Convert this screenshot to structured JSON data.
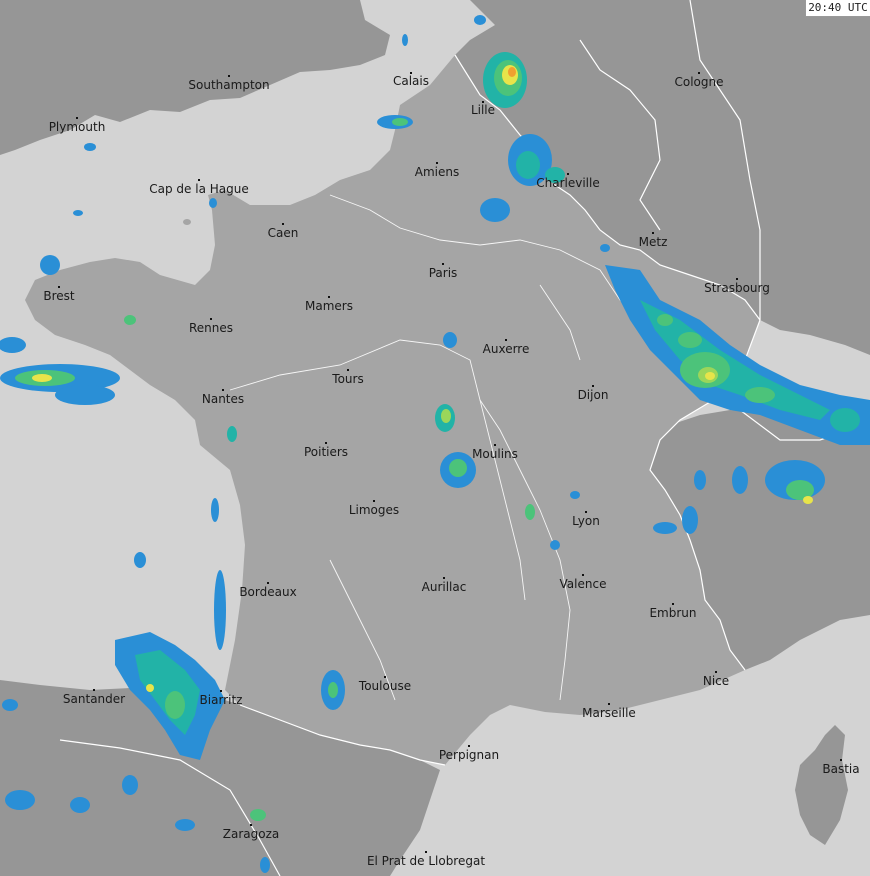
{
  "timestamp": "20:40 UTC",
  "colors": {
    "sea": "#d3d3d3",
    "land_france": "#a5a5a5",
    "land_neighbors": "#969696",
    "borders": "#ffffff",
    "rivers": "#ffffff",
    "radar_scale": [
      "#2a8fd6",
      "#22b3a7",
      "#4cc37a",
      "#9bd65a",
      "#e8e44a",
      "#f0a030",
      "#e85030"
    ]
  },
  "cities": [
    {
      "name": "Southampton"
    },
    {
      "name": "Calais"
    },
    {
      "name": "Cologne"
    },
    {
      "name": "Plymouth"
    },
    {
      "name": "Lille"
    },
    {
      "name": "Amiens"
    },
    {
      "name": "Charleville"
    },
    {
      "name": "Cap de la Hague"
    },
    {
      "name": "Caen"
    },
    {
      "name": "Metz"
    },
    {
      "name": "Paris"
    },
    {
      "name": "Brest"
    },
    {
      "name": "Strasbourg"
    },
    {
      "name": "Mamers"
    },
    {
      "name": "Rennes"
    },
    {
      "name": "Auxerre"
    },
    {
      "name": "Tours"
    },
    {
      "name": "Nantes"
    },
    {
      "name": "Dijon"
    },
    {
      "name": "Poitiers"
    },
    {
      "name": "Moulins"
    },
    {
      "name": "Limoges"
    },
    {
      "name": "Lyon"
    },
    {
      "name": "Valence"
    },
    {
      "name": "Aurillac"
    },
    {
      "name": "Bordeaux"
    },
    {
      "name": "Embrun"
    },
    {
      "name": "Nice"
    },
    {
      "name": "Toulouse"
    },
    {
      "name": "Santander"
    },
    {
      "name": "Biarritz"
    },
    {
      "name": "Marseille"
    },
    {
      "name": "Perpignan"
    },
    {
      "name": "Bastia"
    },
    {
      "name": "Zaragoza"
    },
    {
      "name": "El Prat de Llobregat"
    }
  ]
}
